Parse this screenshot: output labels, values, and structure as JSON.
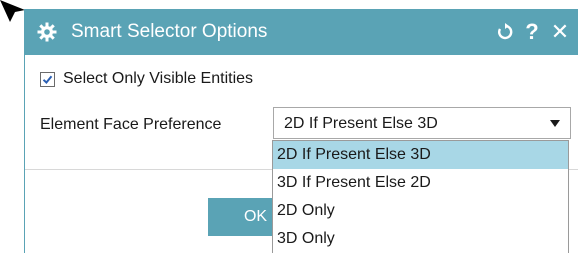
{
  "dialog": {
    "title": "Smart Selector Options",
    "icons": {
      "title": "gear-icon",
      "reset": "reset-icon",
      "help": "help-icon",
      "close": "close-icon"
    },
    "help_label": "?",
    "close_label": "✕"
  },
  "options": {
    "visible_only": {
      "label": "Select Only Visible Entities",
      "checked": true
    },
    "face_preference": {
      "label": "Element Face Preference",
      "value": "2D If Present Else 3D",
      "items": [
        "2D If Present Else 3D",
        "3D If Present Else 2D",
        "2D Only",
        "3D Only"
      ],
      "highlighted_index": 0
    }
  },
  "actions": {
    "ok_label": "OK"
  },
  "colors": {
    "accent": "#5aa3b5",
    "highlight": "#a8d7e6"
  }
}
